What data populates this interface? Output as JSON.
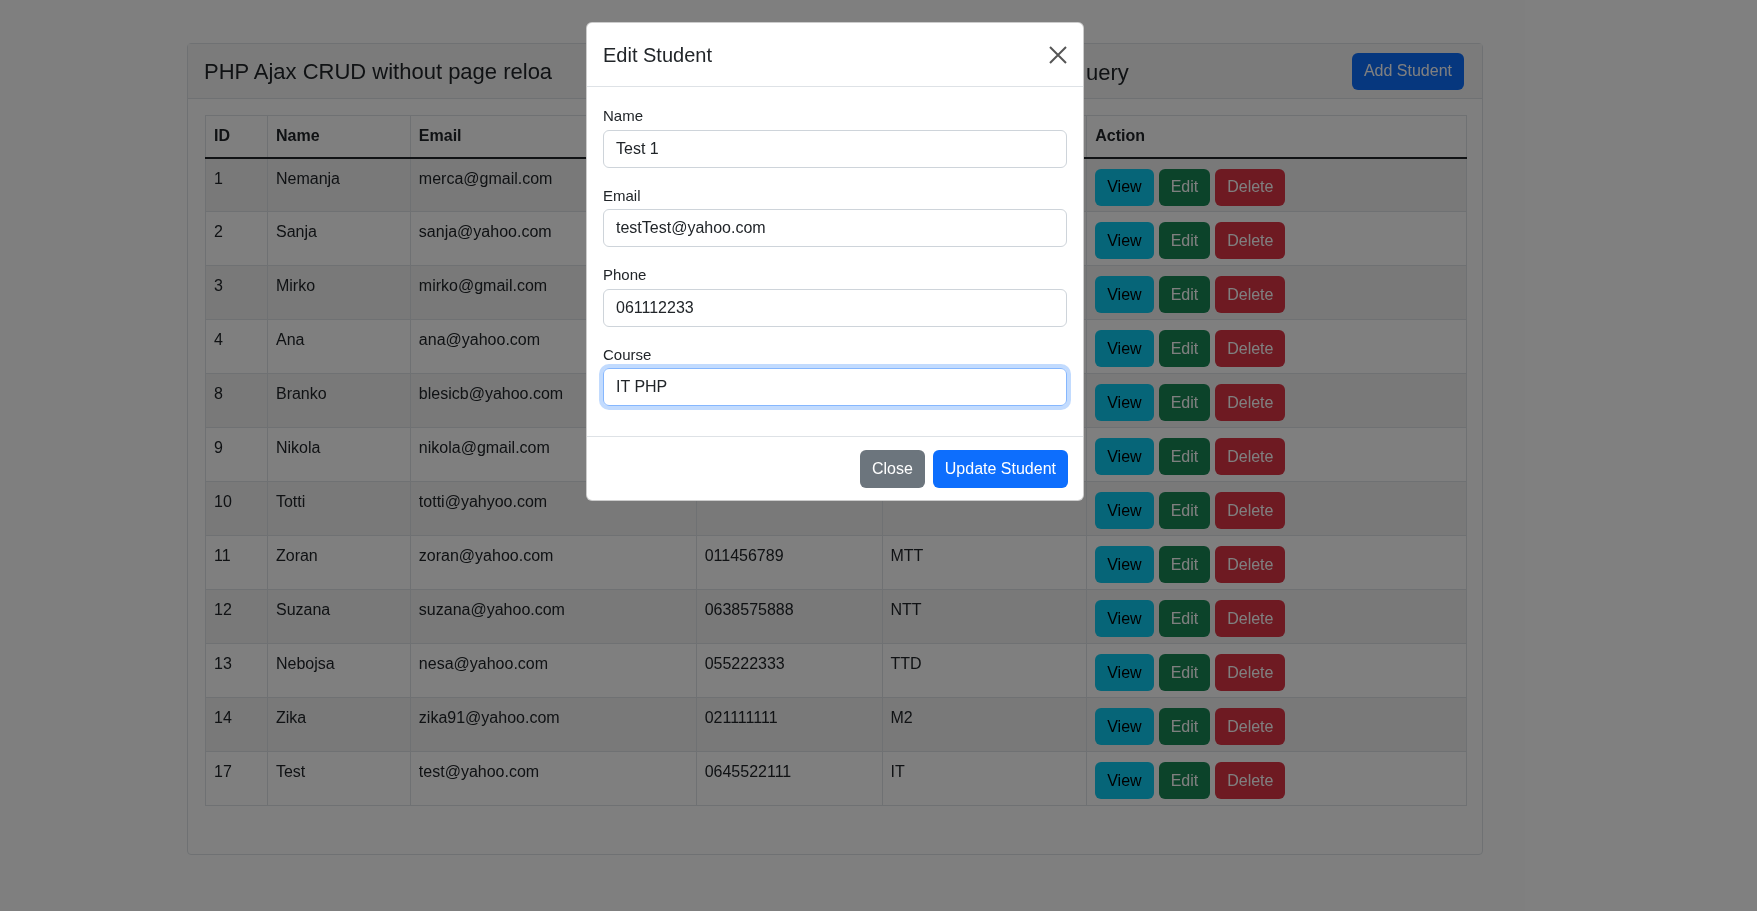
{
  "card": {
    "title_parts": [
      "PHP Ajax CRUD without page reloa",
      "uery"
    ],
    "add_button": "Add Student"
  },
  "table": {
    "columns": [
      {
        "label": "ID"
      },
      {
        "label": "Name"
      },
      {
        "label": "Email"
      },
      {},
      {},
      {
        "label": "Action"
      }
    ],
    "rows": [
      {
        "id": "1",
        "name": "Nemanja",
        "email": "merca@gmail.com",
        "actions": [
          {
            "label": "View",
            "kind": "info"
          },
          {
            "label": "Edit",
            "kind": "success"
          },
          {
            "label": "Delete",
            "kind": "danger"
          }
        ]
      },
      {
        "id": "2",
        "name": "Sanja",
        "email": "sanja@yahoo.com",
        "actions": [
          {
            "label": "View",
            "kind": "info"
          },
          {
            "label": "Edit",
            "kind": "success"
          },
          {
            "label": "Delete",
            "kind": "danger"
          }
        ]
      },
      {
        "id": "3",
        "name": "Mirko",
        "email": "mirko@gmail.com",
        "actions": [
          {
            "label": "View",
            "kind": "info"
          },
          {
            "label": "Edit",
            "kind": "success"
          },
          {
            "label": "Delete",
            "kind": "danger"
          }
        ]
      },
      {
        "id": "4",
        "name": "Ana",
        "email": "ana@yahoo.com",
        "actions": [
          {
            "label": "View",
            "kind": "info"
          },
          {
            "label": "Edit",
            "kind": "success"
          },
          {
            "label": "Delete",
            "kind": "danger"
          }
        ]
      },
      {
        "id": "8",
        "name": "Branko",
        "email": "blesicb@yahoo.com",
        "actions": [
          {
            "label": "View",
            "kind": "info"
          },
          {
            "label": "Edit",
            "kind": "success"
          },
          {
            "label": "Delete",
            "kind": "danger"
          }
        ]
      },
      {
        "id": "9",
        "name": "Nikola",
        "email": "nikola@gmail.com",
        "actions": [
          {
            "label": "View",
            "kind": "info"
          },
          {
            "label": "Edit",
            "kind": "success"
          },
          {
            "label": "Delete",
            "kind": "danger"
          }
        ]
      },
      {
        "id": "10",
        "name": "Totti",
        "email": "totti@yahyoo.com",
        "actions": [
          {
            "label": "View",
            "kind": "info"
          },
          {
            "label": "Edit",
            "kind": "success"
          },
          {
            "label": "Delete",
            "kind": "danger"
          }
        ]
      },
      {
        "id": "11",
        "name": "Zoran",
        "email": "zoran@yahoo.com",
        "phone": "011456789",
        "course": "MTT",
        "actions": [
          {
            "label": "View",
            "kind": "info"
          },
          {
            "label": "Edit",
            "kind": "success"
          },
          {
            "label": "Delete",
            "kind": "danger"
          }
        ]
      },
      {
        "id": "12",
        "name": "Suzana",
        "email": "suzana@yahoo.com",
        "phone": "0638575888",
        "course": "NTT",
        "actions": [
          {
            "label": "View",
            "kind": "info"
          },
          {
            "label": "Edit",
            "kind": "success"
          },
          {
            "label": "Delete",
            "kind": "danger"
          }
        ]
      },
      {
        "id": "13",
        "name": "Nebojsa",
        "email": "nesa@yahoo.com",
        "phone": "055222333",
        "course": "TTD",
        "actions": [
          {
            "label": "View",
            "kind": "info"
          },
          {
            "label": "Edit",
            "kind": "success"
          },
          {
            "label": "Delete",
            "kind": "danger"
          }
        ]
      },
      {
        "id": "14",
        "name": "Zika",
        "email": "zika91@yahoo.com",
        "phone": "021111111",
        "course": "M2",
        "actions": [
          {
            "label": "View",
            "kind": "info"
          },
          {
            "label": "Edit",
            "kind": "success"
          },
          {
            "label": "Delete",
            "kind": "danger"
          }
        ]
      },
      {
        "id": "17",
        "name": "Test",
        "email": "test@yahoo.com",
        "phone": "0645522111",
        "course": "IT",
        "actions": [
          {
            "label": "View",
            "kind": "info"
          },
          {
            "label": "Edit",
            "kind": "success"
          },
          {
            "label": "Delete",
            "kind": "danger"
          }
        ]
      }
    ]
  },
  "modal": {
    "title": "Edit Student",
    "fields": [
      {
        "label": "Name",
        "value": "Test 1",
        "focused": false
      },
      {
        "label": "Email",
        "value": "testTest@yahoo.com",
        "focused": false
      },
      {
        "label": "Phone",
        "value": "061112233",
        "focused": false
      },
      {
        "label": "Course",
        "value": "IT PHP",
        "focused": true
      }
    ],
    "buttons": [
      {
        "label": "Close",
        "kind": "secondary"
      },
      {
        "label": "Update Student",
        "kind": "primary"
      }
    ]
  }
}
